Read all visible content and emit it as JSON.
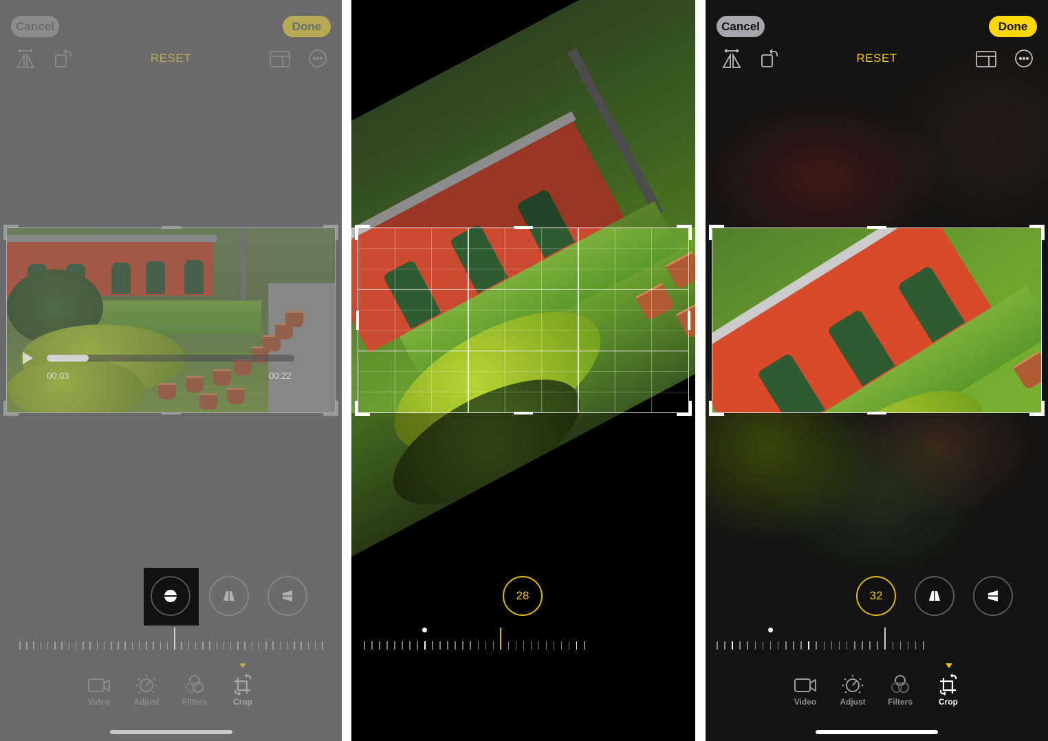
{
  "screens": [
    {
      "id": "before",
      "header": {
        "cancel_label": "Cancel",
        "done_label": "Done",
        "reset_label": "RESET"
      },
      "toolbar_icons": [
        "flip-horizontal-icon",
        "rotate-icon",
        "aspect-ratio-icon",
        "more-icon"
      ],
      "video": {
        "current_time": "00:03",
        "duration": "00:22",
        "progress_fraction": 0.17
      },
      "tools": [
        {
          "name": "straighten",
          "icon": "straighten-icon",
          "selected": true
        },
        {
          "name": "vertical-perspective",
          "icon": "vertical-perspective-icon",
          "selected": false
        },
        {
          "name": "horizontal-perspective",
          "icon": "horizontal-perspective-icon",
          "selected": false
        }
      ],
      "ruler_value": 0,
      "tabs": [
        {
          "label": "Video",
          "icon": "video-camera-icon"
        },
        {
          "label": "Adjust",
          "icon": "adjust-dial-icon"
        },
        {
          "label": "Filters",
          "icon": "filters-icon"
        },
        {
          "label": "Crop",
          "icon": "crop-rotate-icon",
          "active": true
        }
      ]
    },
    {
      "id": "adjusting",
      "straighten_value": "28",
      "ruler_value": 28
    },
    {
      "id": "after",
      "header": {
        "cancel_label": "Cancel",
        "done_label": "Done",
        "reset_label": "RESET"
      },
      "toolbar_icons": [
        "flip-horizontal-icon",
        "rotate-icon",
        "aspect-ratio-icon",
        "more-icon"
      ],
      "straighten_value": "32",
      "ruler_value": 32,
      "tools": [
        {
          "name": "straighten",
          "icon": "straighten-icon",
          "selected": true
        },
        {
          "name": "vertical-perspective",
          "icon": "vertical-perspective-icon",
          "selected": false
        },
        {
          "name": "horizontal-perspective",
          "icon": "horizontal-perspective-icon",
          "selected": false
        }
      ],
      "tabs": [
        {
          "label": "Video",
          "icon": "video-camera-icon"
        },
        {
          "label": "Adjust",
          "icon": "adjust-dial-icon"
        },
        {
          "label": "Filters",
          "icon": "filters-icon"
        },
        {
          "label": "Crop",
          "icon": "crop-rotate-icon",
          "active": true
        }
      ]
    }
  ],
  "colors": {
    "accent_yellow": "#f5c60a",
    "done_yellow": "#fed60a"
  }
}
